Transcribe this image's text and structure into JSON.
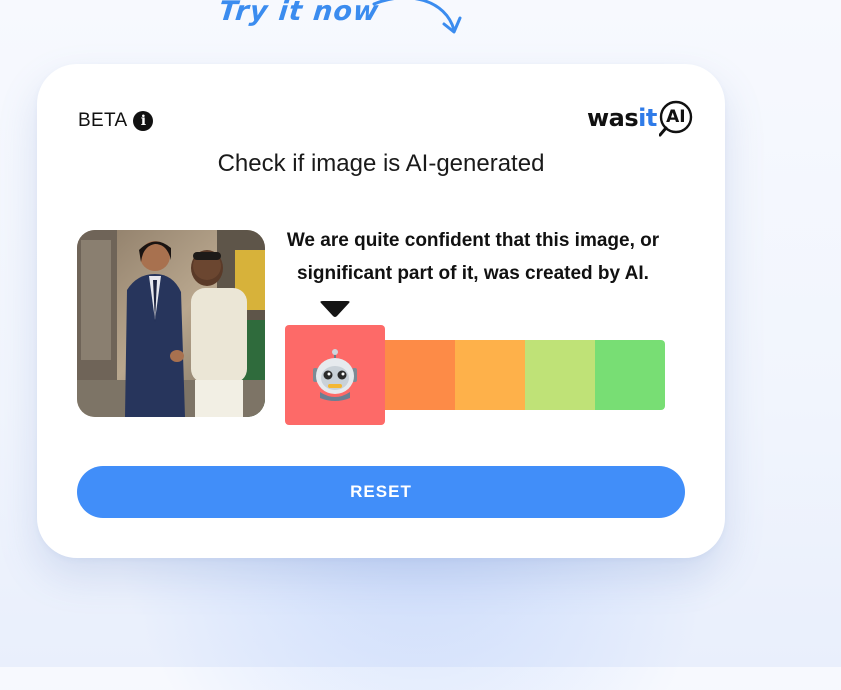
{
  "promo": {
    "try_now": "Try it now"
  },
  "card": {
    "beta_label": "BETA",
    "info_icon": "info-icon",
    "logo": {
      "was": "was",
      "it": "it",
      "ai": "AI"
    },
    "subtitle": "Check if image is AI-generated",
    "result_line1": "We are quite confident that this image, or",
    "result_line2": "significant part of it, was created by AI.",
    "meter": {
      "selected_index": 0,
      "selected_icon": "robot-icon",
      "segment_colors": [
        "#fd6a68",
        "#fd8b47",
        "#feb14a",
        "#bfe277",
        "#78de74"
      ]
    },
    "reset_label": "RESET"
  },
  "colors": {
    "accent": "#418ef9",
    "brand_blue": "#2f7be8"
  }
}
